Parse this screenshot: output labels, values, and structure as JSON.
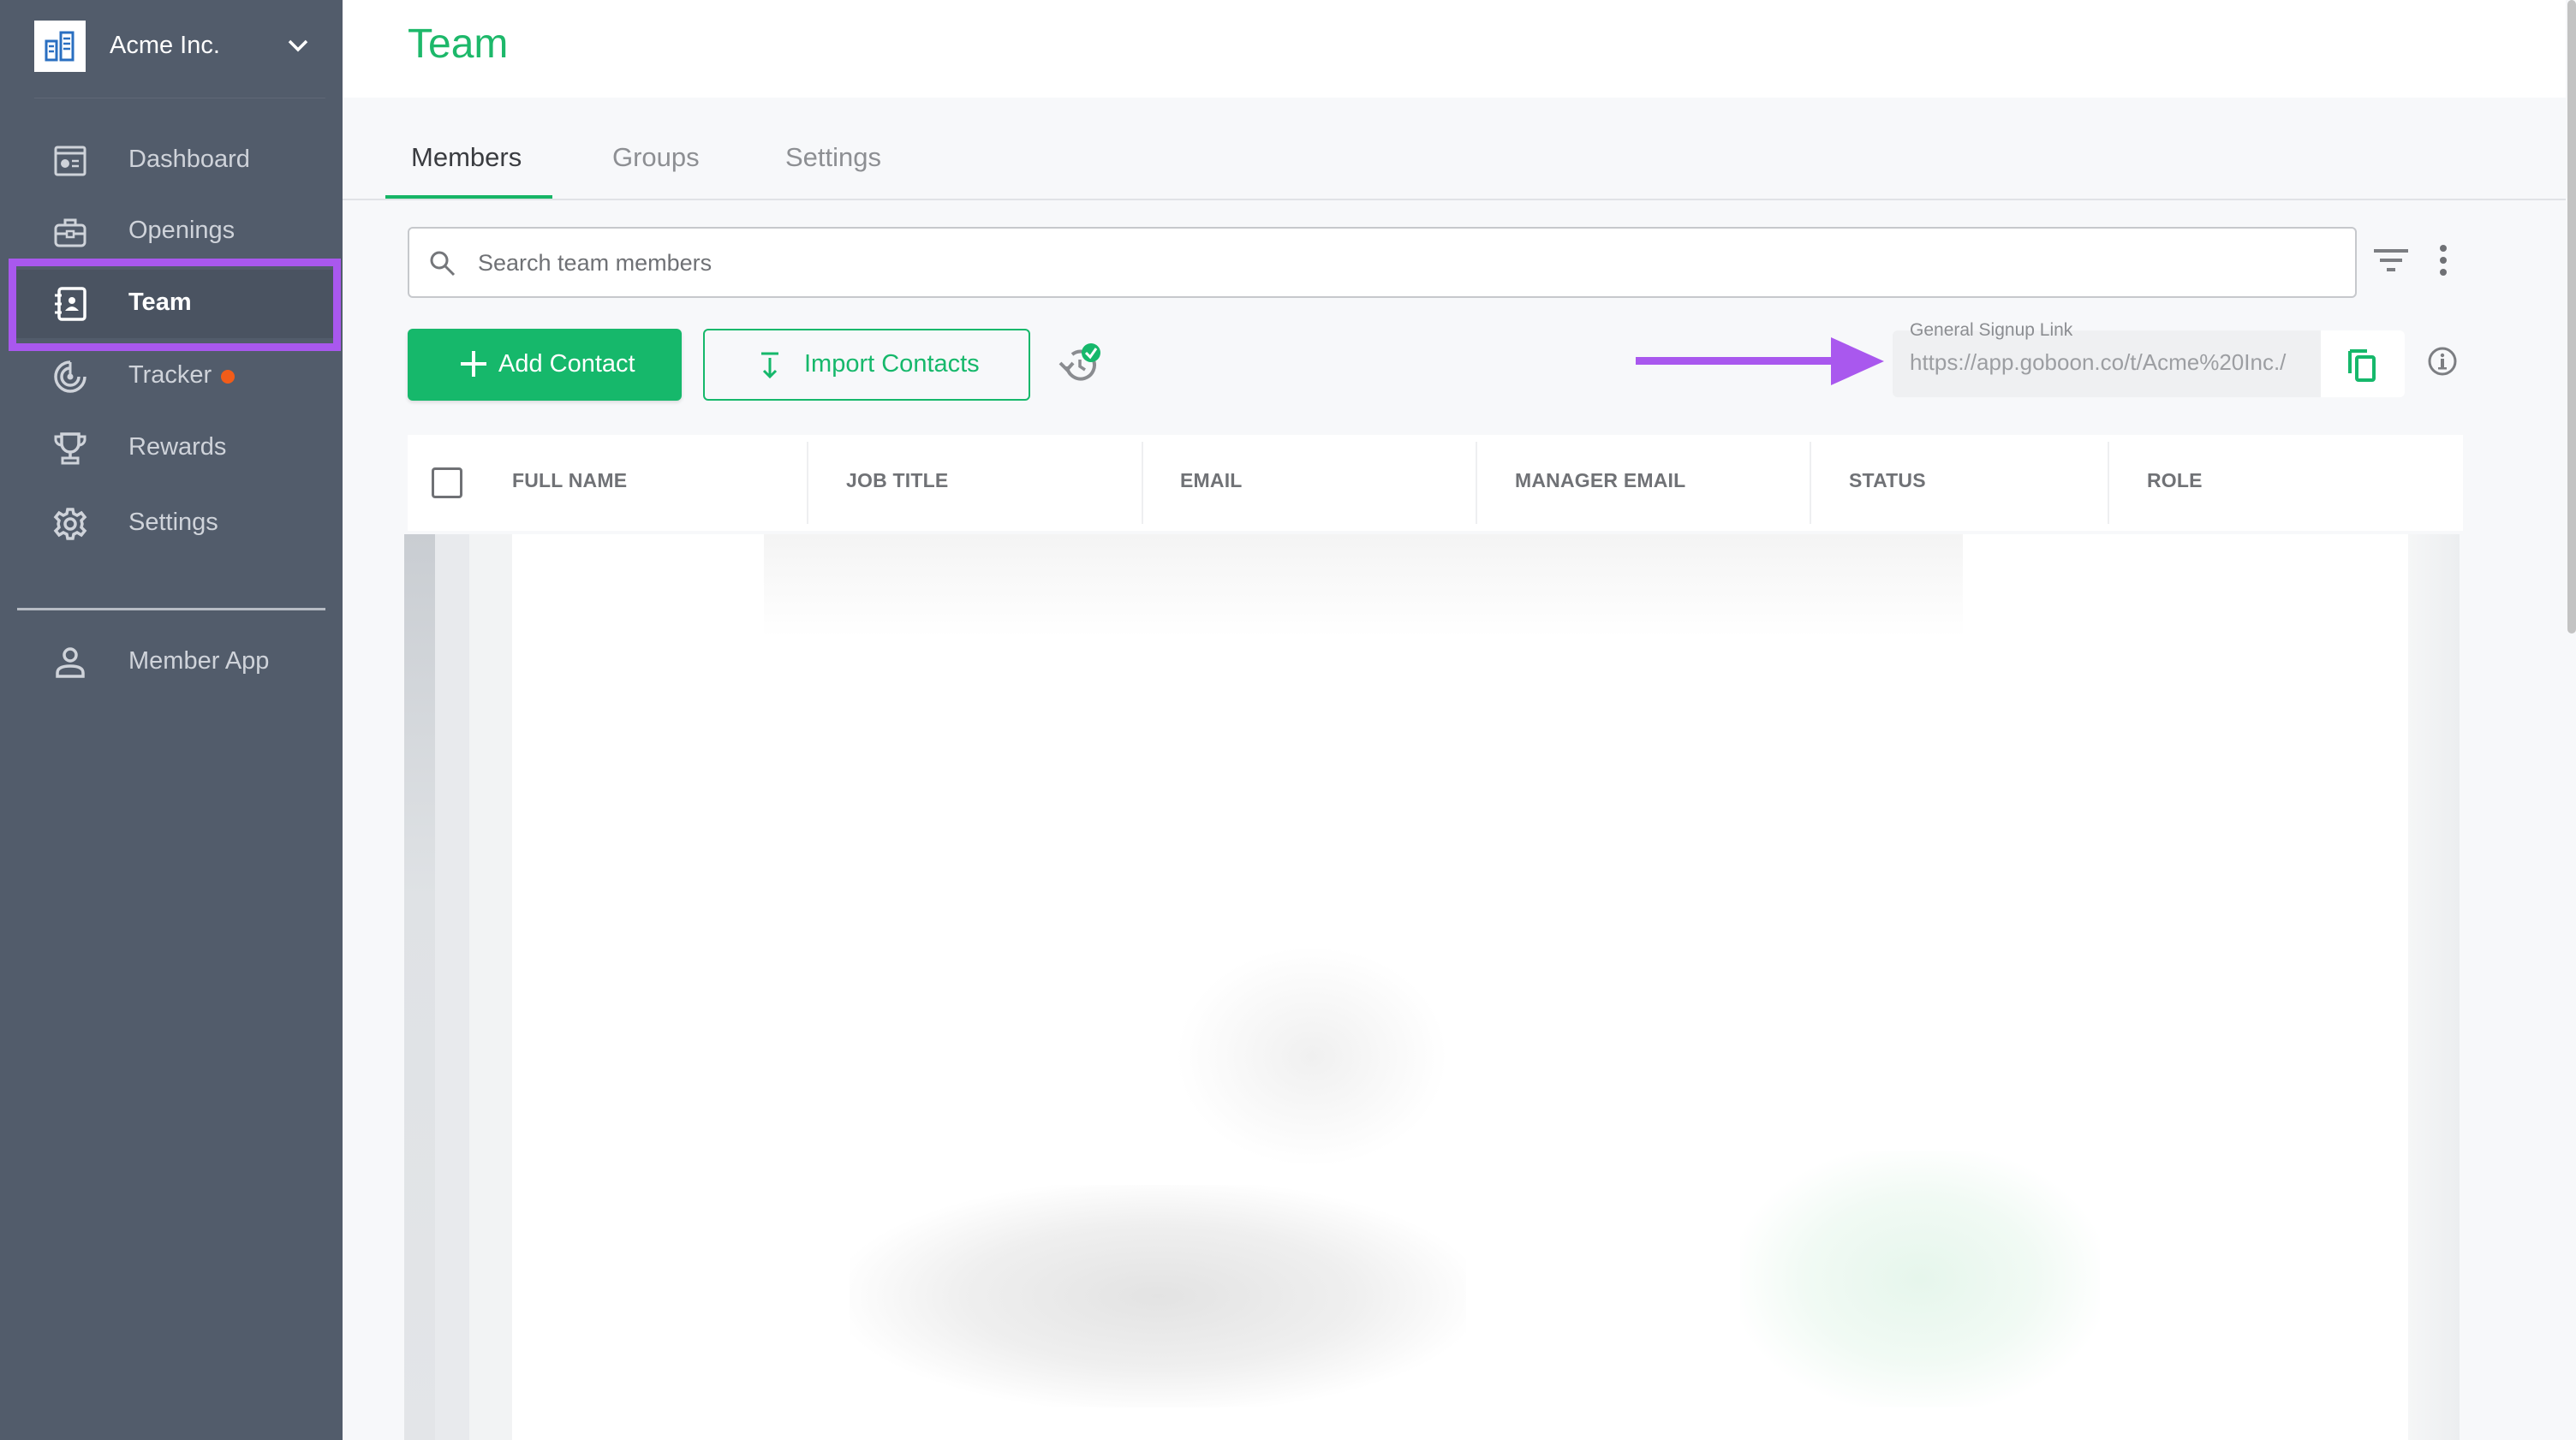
{
  "sidebar": {
    "org_name": "Acme Inc.",
    "items": [
      {
        "label": "Dashboard",
        "icon": "dashboard-icon",
        "active": false
      },
      {
        "label": "Openings",
        "icon": "briefcase-icon",
        "active": false
      },
      {
        "label": "Team",
        "icon": "contacts-book-icon",
        "active": true
      },
      {
        "label": "Tracker",
        "icon": "radar-icon",
        "active": false,
        "notification_dot": true
      },
      {
        "label": "Rewards",
        "icon": "trophy-icon",
        "active": false
      },
      {
        "label": "Settings",
        "icon": "gear-icon",
        "active": false
      }
    ],
    "secondary_items": [
      {
        "label": "Member App",
        "icon": "person-icon"
      }
    ]
  },
  "header": {
    "title": "Team"
  },
  "tabs": [
    {
      "label": "Members",
      "active": true
    },
    {
      "label": "Groups",
      "active": false
    },
    {
      "label": "Settings",
      "active": false
    }
  ],
  "search": {
    "placeholder": "Search team members",
    "value": ""
  },
  "toolbar": {
    "add_contact_label": "Add Contact",
    "import_contacts_label": "Import Contacts",
    "signup_link_label": "General Signup Link",
    "signup_link_value": "https://app.goboon.co/t/Acme%20Inc./"
  },
  "table": {
    "columns": [
      "FULL NAME",
      "JOB TITLE",
      "EMAIL",
      "MANAGER EMAIL",
      "STATUS",
      "ROLE"
    ],
    "rows_redacted": true
  },
  "colors": {
    "brand_green": "#16b86b",
    "sidebar_bg": "#525c6b",
    "annotation_purple": "#a958ee",
    "notification_orange": "#f25c19"
  }
}
